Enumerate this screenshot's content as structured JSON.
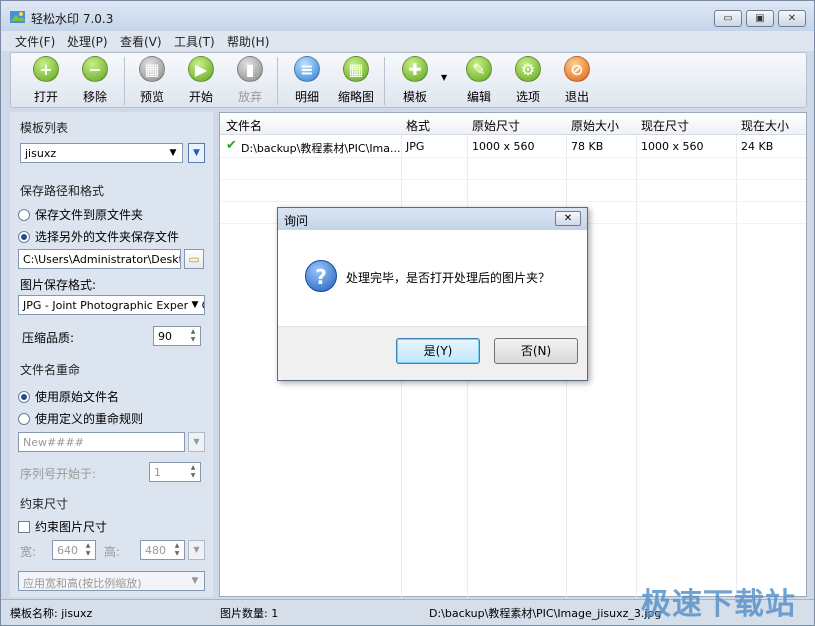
{
  "window": {
    "title": "轻松水印 7.0.3",
    "min": "▭",
    "max": "▣",
    "close": "✕"
  },
  "menu": [
    "文件(F)",
    "处理(P)",
    "查看(V)",
    "工具(T)",
    "帮助(H)"
  ],
  "toolbar": {
    "open": "打开",
    "remove": "移除",
    "preview": "预览",
    "start": "开始",
    "abandon": "放弃",
    "detail": "明细",
    "thumbnail": "缩略图",
    "template": "模板",
    "edit": "编辑",
    "options": "选项",
    "exit": "退出"
  },
  "left": {
    "template_list_title": "模板列表",
    "template_value": "jisuxz",
    "save_path_title": "保存路径和格式",
    "save_to_original": "保存文件到原文件夹",
    "save_to_other": "选择另外的文件夹保存文件",
    "path_value": "C:\\Users\\Administrator\\Desktop\\",
    "format_label": "图片保存格式:",
    "format_value": "JPG - Joint Photographic Experts Group",
    "quality_label": "压缩品质:",
    "quality_value": "90",
    "rename_title": "文件名重命",
    "use_original_name": "使用原始文件名",
    "use_custom_rule": "使用定义的重命规则",
    "rule_placeholder": "New####",
    "seq_label": "序列号开始于:",
    "seq_value": "1",
    "constraint_title": "约束尺寸",
    "constrain_size": "约束图片尺寸",
    "width_label": "宽:",
    "width_value": "640",
    "height_label": "高:",
    "height_value": "480",
    "apply_mode": "应用宽和高(按比例缩放)"
  },
  "table": {
    "headers": [
      "文件名",
      "格式",
      "原始尺寸",
      "原始大小",
      "现在尺寸",
      "现在大小"
    ],
    "rows": [
      {
        "name": "D:\\backup\\教程素材\\PIC\\Ima...",
        "format": "JPG",
        "orig_dim": "1000 x 560",
        "orig_size": "78 KB",
        "new_dim": "1000 x 560",
        "new_size": "24 KB"
      }
    ]
  },
  "status": {
    "template_name": "模板名称:  jisuxz",
    "image_count": "图片数量:   1",
    "path": "D:\\backup\\教程素材\\PIC\\Image_jisuxz_3.jpg"
  },
  "dialog": {
    "title": "询问",
    "close": "✕",
    "message": "处理完毕，是否打开处理后的图片夹？",
    "yes": "是(Y)",
    "no": "否(N)"
  },
  "watermark": "极速下载站"
}
